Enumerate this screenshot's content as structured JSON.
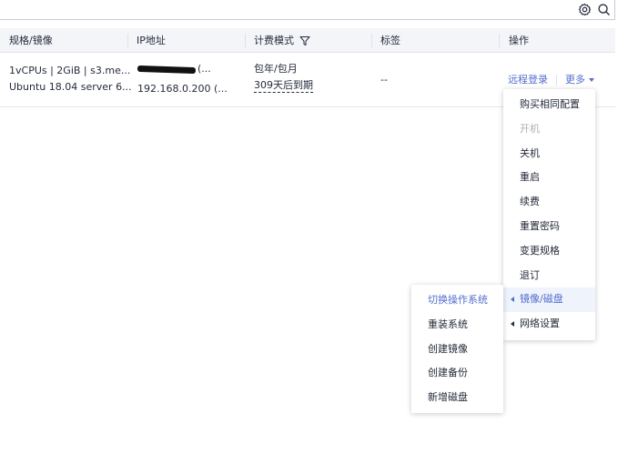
{
  "colors": {
    "accent": "#526ecc",
    "header_bg": "#f3f5f9",
    "text": "#252b3a",
    "disabled": "#adb0b8",
    "active_bg": "#eff3fc"
  },
  "toolbar": {
    "icons": [
      "gear-icon",
      "search-icon"
    ]
  },
  "table": {
    "columns": [
      "规格/镜像",
      "IP地址",
      "计费模式",
      "标签",
      "操作"
    ],
    "filter_icon": "filter-icon",
    "row": {
      "spec_line1": "1vCPUs | 2GiB | s3.me...",
      "spec_line2": "Ubuntu 18.04 server 6...",
      "ip_line1_suffix": "(...",
      "ip_line2": "192.168.0.200  (...",
      "billing_line1": "包年/包月",
      "billing_line2": "309天后到期",
      "tag": "--",
      "op_remote_login": "远程登录",
      "op_more": "更多"
    }
  },
  "more_menu": {
    "items": [
      {
        "label": "购买相同配置",
        "disabled": false,
        "has_submenu": false
      },
      {
        "label": "开机",
        "disabled": true,
        "has_submenu": false
      },
      {
        "label": "关机",
        "disabled": false,
        "has_submenu": false
      },
      {
        "label": "重启",
        "disabled": false,
        "has_submenu": false
      },
      {
        "label": "续费",
        "disabled": false,
        "has_submenu": false
      },
      {
        "label": "重置密码",
        "disabled": false,
        "has_submenu": false
      },
      {
        "label": "变更规格",
        "disabled": false,
        "has_submenu": false
      },
      {
        "label": "退订",
        "disabled": false,
        "has_submenu": false
      },
      {
        "label": "镜像/磁盘",
        "disabled": false,
        "has_submenu": true,
        "active": true
      },
      {
        "label": "网络设置",
        "disabled": false,
        "has_submenu": true
      }
    ]
  },
  "submenu": {
    "items": [
      {
        "label": "切换操作系统",
        "highlighted": true
      },
      {
        "label": "重装系统"
      },
      {
        "label": "创建镜像"
      },
      {
        "label": "创建备份"
      },
      {
        "label": "新增磁盘"
      }
    ]
  }
}
